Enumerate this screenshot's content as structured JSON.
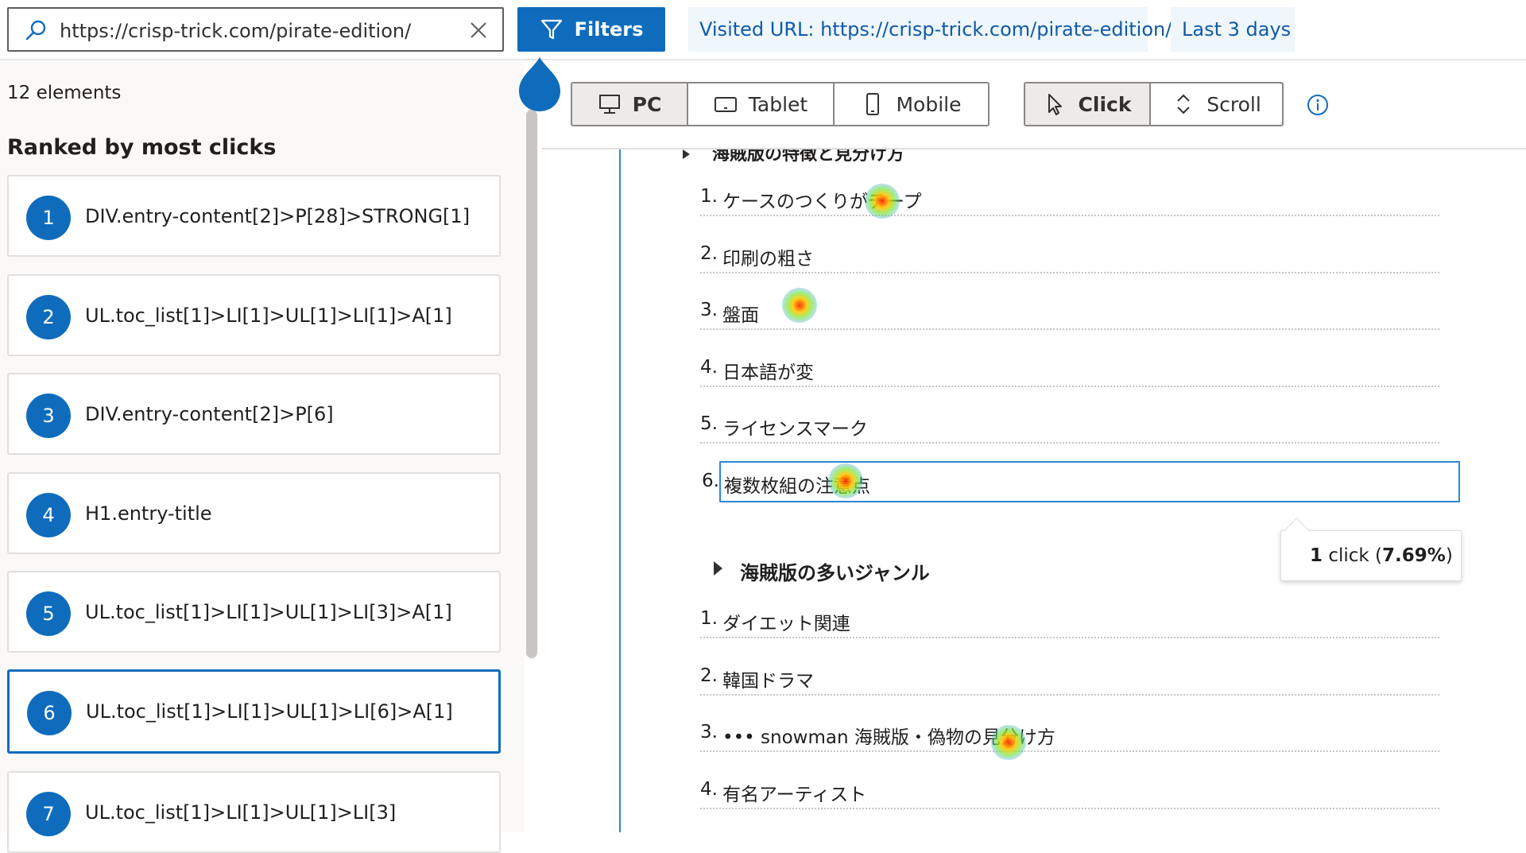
{
  "topbar": {
    "search_value": "https://crisp-trick.com/pirate-edition/",
    "filters_label": "Filters",
    "chip_url": "Visited URL: https://crisp-trick.com/pirate-edition/",
    "chip_date": "Last 3 days"
  },
  "sidebar": {
    "count": "12 elements",
    "ranked_title": "Ranked by most clicks",
    "items": [
      {
        "rank": "1",
        "selector": "DIV.entry-content[2]>P[28]>STRONG[1]"
      },
      {
        "rank": "2",
        "selector": "UL.toc_list[1]>LI[1]>UL[1]>LI[1]>A[1]"
      },
      {
        "rank": "3",
        "selector": "DIV.entry-content[2]>P[6]"
      },
      {
        "rank": "4",
        "selector": "H1.entry-title"
      },
      {
        "rank": "5",
        "selector": "UL.toc_list[1]>LI[1]>UL[1]>LI[3]>A[1]"
      },
      {
        "rank": "6",
        "selector": "UL.toc_list[1]>LI[1]>UL[1]>LI[6]>A[1]"
      },
      {
        "rank": "7",
        "selector": "UL.toc_list[1]>LI[1]>UL[1]>LI[3]"
      }
    ],
    "selected_rank": "6"
  },
  "toolbar": {
    "devices": [
      "PC",
      "Tablet",
      "Mobile"
    ],
    "active_device": "PC",
    "modes": [
      "Click",
      "Scroll"
    ],
    "active_mode": "Click"
  },
  "preview": {
    "cut_heading": "海賊版の特徴と見分け方",
    "list1": [
      {
        "n": "1.",
        "t": "ケースのつくりがチープ"
      },
      {
        "n": "2.",
        "t": "印刷の粗さ"
      },
      {
        "n": "3.",
        "t": "盤面"
      },
      {
        "n": "4.",
        "t": "日本語が変"
      },
      {
        "n": "5.",
        "t": "ライセンスマーク"
      },
      {
        "n": "6.",
        "t": "複数枚組の注意点"
      }
    ],
    "section_heading": "海賊版の多いジャンル",
    "list2": [
      {
        "n": "1.",
        "t": "ダイエット関連"
      },
      {
        "n": "2.",
        "t": "韓国ドラマ"
      },
      {
        "n": "3.",
        "t": "••• snowman 海賊版・偽物の見分け方"
      },
      {
        "n": "4.",
        "t": "有名アーティスト"
      }
    ],
    "tooltip_count": "1",
    "tooltip_word": "click",
    "tooltip_pct": "7.69%"
  },
  "colors": {
    "accent": "#0f6cbd",
    "chip_bg": "#eff6fc",
    "highlight_border": "#2b88d8"
  }
}
